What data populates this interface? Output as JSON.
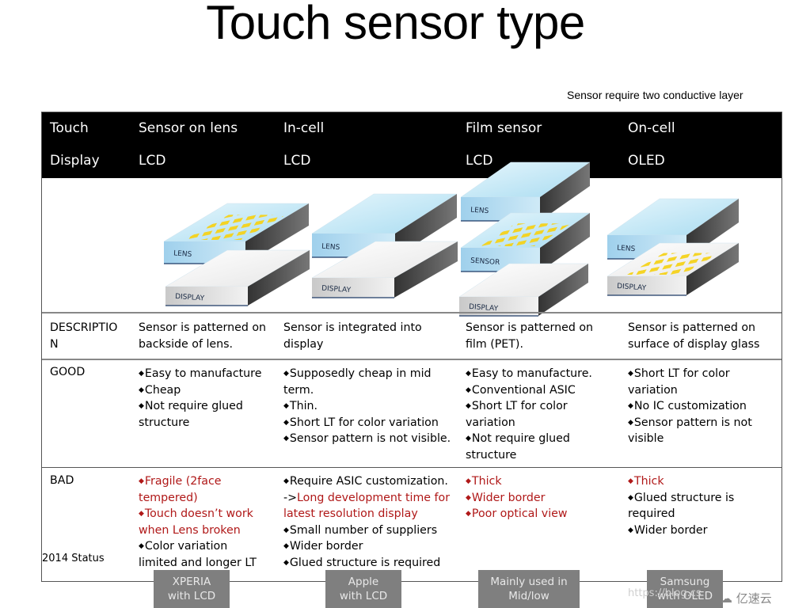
{
  "title": "Touch sensor type",
  "note": "Sensor require two conductive layer",
  "header": {
    "row1_label": "Touch",
    "row2_label": "Display",
    "columns": [
      {
        "touch": "Sensor on lens",
        "display": "LCD"
      },
      {
        "touch": "In-cell",
        "display": "LCD"
      },
      {
        "touch": "Film sensor",
        "display": "LCD"
      },
      {
        "touch": "On-cell",
        "display": "OLED"
      }
    ]
  },
  "diagram_labels": {
    "lens": "LENS",
    "sensor": "SENSOR",
    "display": "DISPLAY"
  },
  "colors": {
    "header_bg": "#000000",
    "bad_highlight": "#b01818",
    "status_tag_bg": "#7f7f7f",
    "sensor_pattern": "#f5d21a",
    "lens_blue": "#bfe4f5"
  },
  "rows": {
    "description": {
      "label": "DESCRIPTIO\nN",
      "label_line1": "DESCRIPTIO",
      "label_line2": "N",
      "cells": [
        [
          "Sensor is patterned on",
          "backside of lens."
        ],
        [
          "Sensor is integrated into",
          "display"
        ],
        [
          "Sensor is patterned on",
          "film (PET)."
        ],
        [
          "Sensor is patterned on",
          "surface of display glass"
        ]
      ]
    },
    "good": {
      "label": "GOOD",
      "cells": [
        [
          {
            "text": "Easy to manufacture",
            "bullet": true
          },
          {
            "text": "Cheap",
            "bullet": true
          },
          {
            "text": "Not require glued",
            "bullet": true
          },
          {
            "text": "structure",
            "bullet": false
          }
        ],
        [
          {
            "text": "Supposedly cheap in mid",
            "bullet": true
          },
          {
            "text": "term.",
            "bullet": false
          },
          {
            "text": "Thin.",
            "bullet": true
          },
          {
            "text": "Short  LT for color variation",
            "bullet": true
          },
          {
            "text": "Sensor pattern is not visible.",
            "bullet": true
          }
        ],
        [
          {
            "text": "Easy to manufacture.",
            "bullet": true
          },
          {
            "text": "Conventional ASIC",
            "bullet": true
          },
          {
            "text": "Short  LT for color",
            "bullet": true
          },
          {
            "text": "variation",
            "bullet": false
          },
          {
            "text": "Not require glued",
            "bullet": true
          },
          {
            "text": "structure",
            "bullet": false
          }
        ],
        [
          {
            "text": "Short  LT for color",
            "bullet": true
          },
          {
            "text": "variation",
            "bullet": false
          },
          {
            "text": "No IC customization",
            "bullet": true
          },
          {
            "text": "Sensor pattern is not",
            "bullet": true
          },
          {
            "text": "visible",
            "bullet": false
          }
        ]
      ]
    },
    "bad": {
      "label": "BAD",
      "cells": [
        [
          {
            "text": "Fragile (2face",
            "bullet": true,
            "red": true
          },
          {
            "text": "tempered)",
            "bullet": false,
            "red": true
          },
          {
            "text": "Touch doesn’t work",
            "bullet": true,
            "red": true
          },
          {
            "text": "when Lens broken",
            "bullet": false,
            "red": true
          },
          {
            "text": "Color variation",
            "bullet": true,
            "red": false
          },
          {
            "text": "limited and longer LT",
            "bullet": false,
            "red": false
          }
        ],
        [
          {
            "text": "Require ASIC customization.",
            "bullet": true,
            "red": false
          },
          {
            "text": " ->",
            "bullet": false,
            "red": false,
            "suffix": "Long development time for",
            "suffix_red": true
          },
          {
            "text": "latest resolution display",
            "bullet": false,
            "red": true
          },
          {
            "text": "Small number of suppliers",
            "bullet": true,
            "red": false
          },
          {
            "text": "Wider border",
            "bullet": true,
            "red": false
          },
          {
            "text": "Glued structure is required",
            "bullet": true,
            "red": false
          }
        ],
        [
          {
            "text": "Thick",
            "bullet": true,
            "red": true
          },
          {
            "text": "Wider border",
            "bullet": true,
            "red": true
          },
          {
            "text": "Poor optical view",
            "bullet": true,
            "red": true
          }
        ],
        [
          {
            "text": "Thick",
            "bullet": true,
            "red": true
          },
          {
            "text": "Glued structure is",
            "bullet": true,
            "red": false
          },
          {
            "text": "required",
            "bullet": false,
            "red": false
          },
          {
            "text": "Wider border",
            "bullet": true,
            "red": false
          }
        ]
      ]
    }
  },
  "status": {
    "label": "2014 Status",
    "tags": [
      [
        "XPERIA",
        "with LCD"
      ],
      [
        "Apple",
        "with LCD"
      ],
      [
        "Mainly used in",
        "Mid/low"
      ],
      [
        "Samsung",
        "with OLED"
      ]
    ]
  },
  "watermark": {
    "url_fragment": "https://blog.cs",
    "brand": "亿速云"
  }
}
